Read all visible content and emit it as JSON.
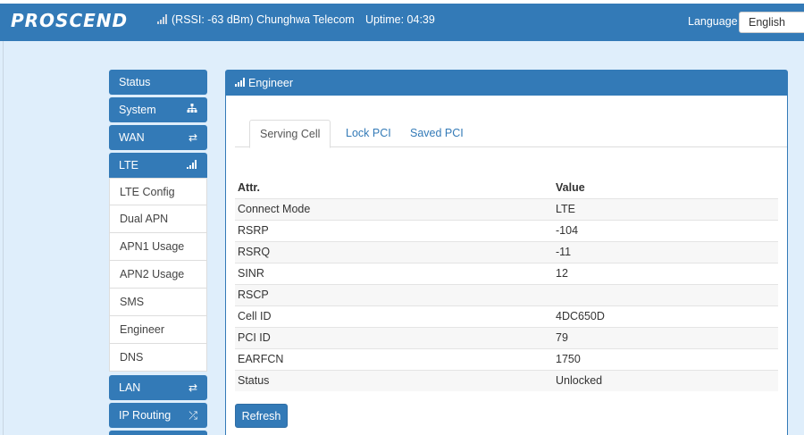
{
  "header": {
    "brand": "PROSCEND",
    "rssi_text": "(RSSI: -63 dBm) Chunghwa Telecom",
    "uptime_text": "Uptime: 04:39",
    "language_label": "Language",
    "language_value": "English"
  },
  "sidebar": {
    "status": "Status",
    "system": "System",
    "wan": "WAN",
    "lte": "LTE",
    "lte_items": [
      "LTE Config",
      "Dual APN",
      "APN1 Usage",
      "APN2 Usage",
      "SMS",
      "Engineer",
      "DNS"
    ],
    "lan": "LAN",
    "ip_routing": "IP Routing"
  },
  "panel": {
    "title": "Engineer",
    "tabs": [
      "Serving Cell",
      "Lock PCI",
      "Saved PCI"
    ],
    "columns": [
      "Attr.",
      "Value"
    ],
    "rows": [
      {
        "attr": "Connect Mode",
        "value": "LTE"
      },
      {
        "attr": "RSRP",
        "value": "-104"
      },
      {
        "attr": "RSRQ",
        "value": "-11"
      },
      {
        "attr": "SINR",
        "value": "12"
      },
      {
        "attr": "RSCP",
        "value": ""
      },
      {
        "attr": "Cell ID",
        "value": "4DC650D"
      },
      {
        "attr": "PCI ID",
        "value": "79"
      },
      {
        "attr": "EARFCN",
        "value": "1750"
      },
      {
        "attr": "Status",
        "value": "Unlocked"
      }
    ],
    "refresh_label": "Refresh"
  },
  "icons": {
    "system": "sitemap-icon",
    "wan": "exchange-icon",
    "lte": "signal-icon",
    "lan": "exchange-icon",
    "ip_routing": "shuffle-icon"
  },
  "colors": {
    "primary": "#337ab7",
    "background": "#dfeefb"
  }
}
